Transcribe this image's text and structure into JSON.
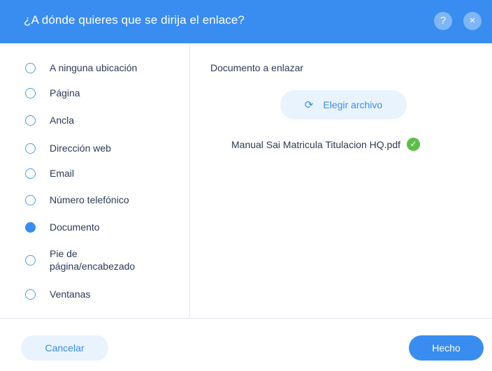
{
  "dialog": {
    "title": "¿A dónde quieres que se dirija el enlace?",
    "help_icon": "?",
    "close_icon": "×"
  },
  "options": [
    {
      "label": "A ninguna ubicación",
      "checked": false
    },
    {
      "label": "Página",
      "checked": false
    },
    {
      "label": "Ancla",
      "checked": false
    },
    {
      "label": "Dirección web",
      "checked": false
    },
    {
      "label": "Email",
      "checked": false
    },
    {
      "label": "Número telefónico",
      "checked": false
    },
    {
      "label": "Documento",
      "checked": true
    },
    {
      "label": "Pie de página/encabezado",
      "checked": false
    },
    {
      "label": "Ventanas",
      "checked": false
    }
  ],
  "document": {
    "heading": "Documento a enlazar",
    "choose_button": "Elegir archivo",
    "choose_icon": "⟳",
    "file_name": "Manual Sai Matricula Titulacion HQ.pdf",
    "check_icon": "✓"
  },
  "footer": {
    "cancel": "Cancelar",
    "done": "Hecho"
  },
  "colors": {
    "accent": "#3a8df0",
    "success": "#5dbe49"
  }
}
